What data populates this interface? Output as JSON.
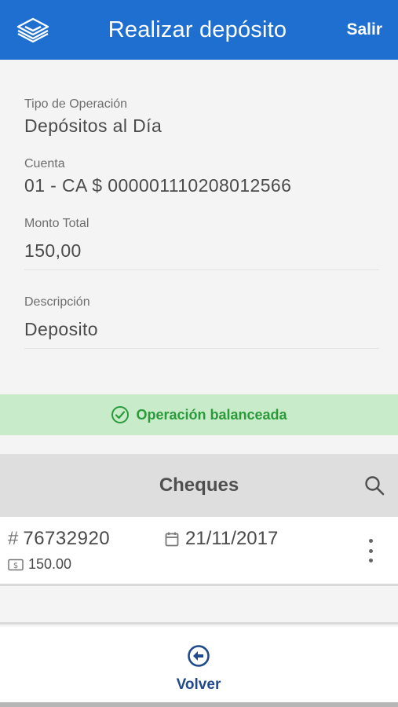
{
  "header": {
    "title": "Realizar depósito",
    "exit_label": "Salir",
    "logo_icon": "stacked-layers-icon",
    "color": "#1f6fd1"
  },
  "form": {
    "operation_type": {
      "label": "Tipo de Operación",
      "value": "Depósitos al Día"
    },
    "account": {
      "label": "Cuenta",
      "value": "01 - CA $ 000001110208012566"
    },
    "total_amount": {
      "label": "Monto Total",
      "value": "150,00"
    },
    "description": {
      "label": "Descripción",
      "value": "Deposito"
    }
  },
  "status": {
    "text": "Operación balanceada",
    "icon": "check-circle-icon",
    "color": "#2b9a3b",
    "background": "#c8ebc9"
  },
  "cheques": {
    "title": "Cheques",
    "search_icon": "search-icon",
    "items": [
      {
        "number": "76732920",
        "date": "21/11/2017",
        "amount": "150.00"
      }
    ]
  },
  "footer": {
    "back_label": "Volver",
    "back_icon": "arrow-left-circle-icon"
  }
}
